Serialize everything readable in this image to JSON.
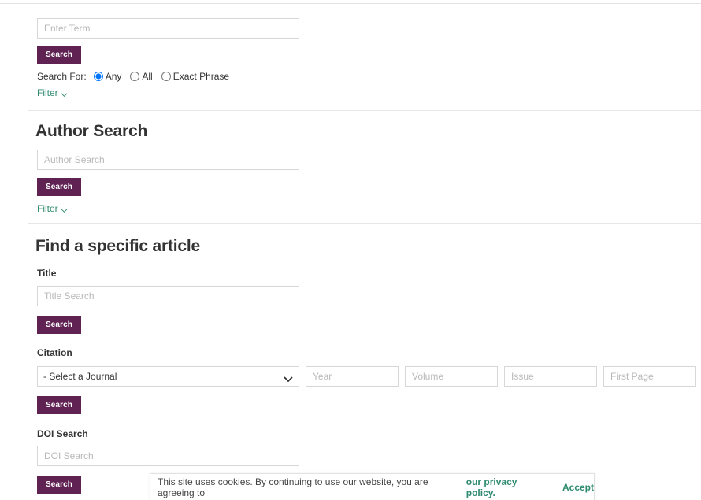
{
  "colors": {
    "button_purple": "#5f2253",
    "link_green": "#2e8b6f",
    "text_dark": "#333333",
    "placeholder_gray": "#b9b9b9",
    "border_gray": "#d7d7d7",
    "rule_gray": "#e6e6e6"
  },
  "basic_search": {
    "input_placeholder": "Enter Term",
    "input_value": "",
    "search_label": "Search",
    "search_for_label": "Search For:",
    "options": [
      {
        "label": "Any",
        "checked": true
      },
      {
        "label": "All",
        "checked": false
      },
      {
        "label": "Exact Phrase",
        "checked": false
      }
    ],
    "filter_label": "Filter"
  },
  "author_search": {
    "heading": "Author Search",
    "input_placeholder": "Author Search",
    "input_value": "",
    "search_label": "Search",
    "filter_label": "Filter"
  },
  "specific_article": {
    "heading": "Find a specific article",
    "title_label": "Title",
    "title_placeholder": "Title Search",
    "title_value": "",
    "title_search_label": "Search",
    "citation_label": "Citation",
    "journal_selected": "- Select a Journal",
    "journal_options": [
      "- Select a Journal"
    ],
    "year_placeholder": "Year",
    "year_value": "",
    "volume_placeholder": "Volume",
    "volume_value": "",
    "issue_placeholder": "Issue",
    "issue_value": "",
    "first_page_placeholder": "First Page",
    "first_page_value": "",
    "citation_search_label": "Search",
    "doi_label": "DOI Search",
    "doi_placeholder": "DOI Search",
    "doi_value": "",
    "doi_search_label": "Search"
  },
  "cookie_banner": {
    "message": "This site uses cookies. By continuing to use our website, you are agreeing to",
    "privacy_link": "our privacy policy.",
    "accept_label": "Accept"
  }
}
